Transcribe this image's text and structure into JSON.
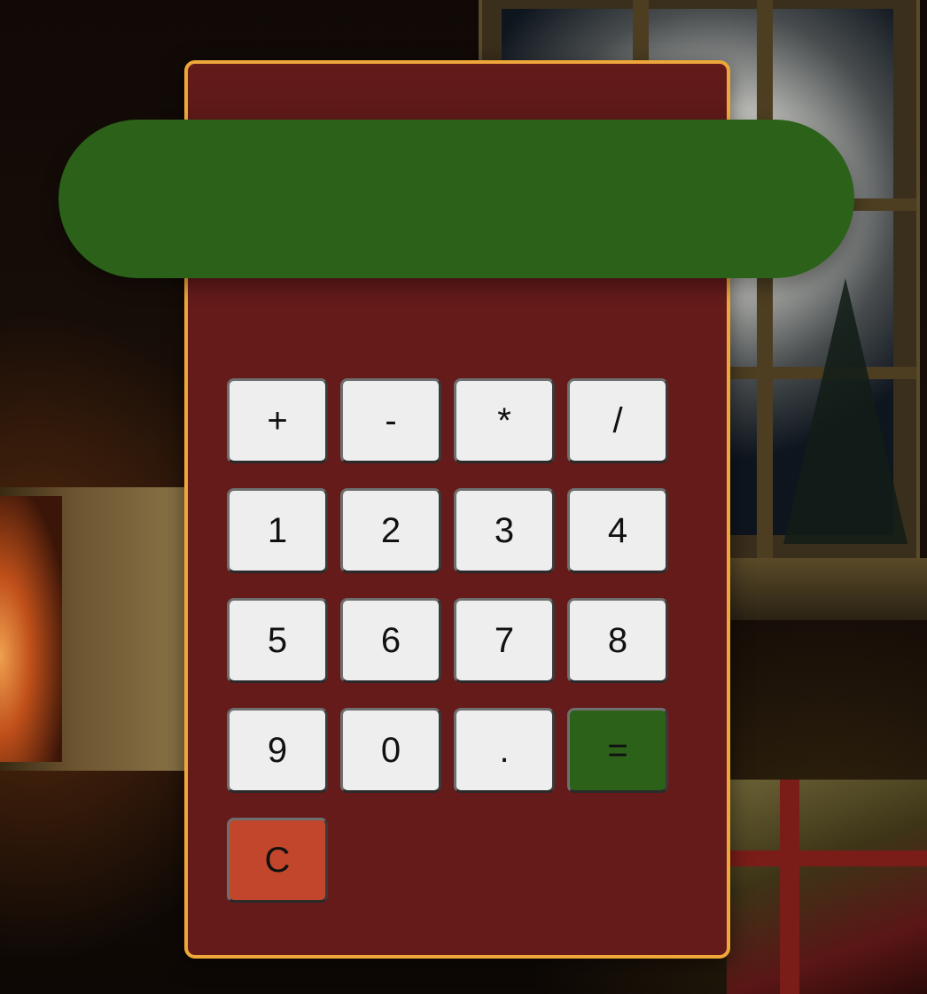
{
  "calculator": {
    "display_value": "",
    "keys": {
      "add": "+",
      "subtract": "-",
      "multiply": "*",
      "divide": "/",
      "one": "1",
      "two": "2",
      "three": "3",
      "four": "4",
      "five": "5",
      "six": "6",
      "seven": "7",
      "eight": "8",
      "nine": "9",
      "zero": "0",
      "decimal": ".",
      "equals": "=",
      "clear": "C"
    }
  },
  "colors": {
    "panel": "#641b1a",
    "panel_border": "#f0a73a",
    "display": "#2b6119",
    "equals_key": "#2b6119",
    "clear_key": "#c2462b",
    "key": "#eeeeee"
  }
}
